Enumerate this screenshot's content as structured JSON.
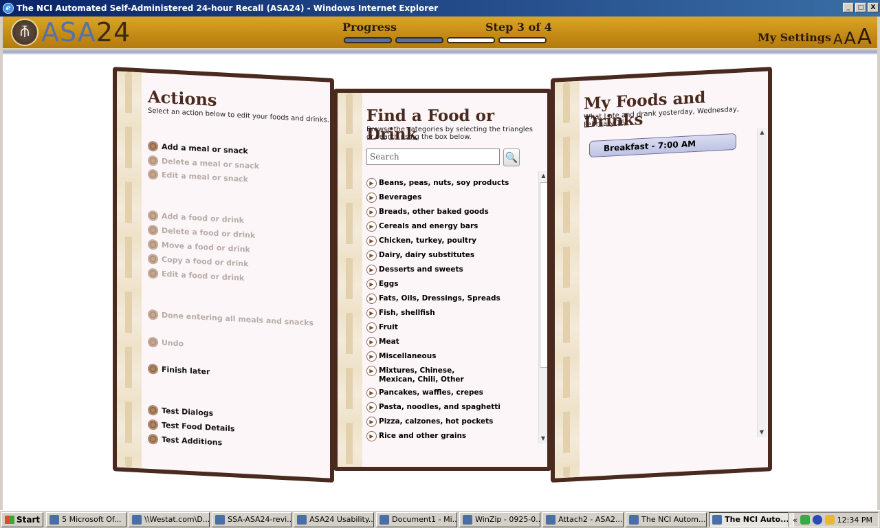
{
  "window": {
    "title": "The NCI Automated Self-Administered 24-hour Recall (ASA24) - Windows Internet Explorer",
    "buttons": [
      "_",
      "□",
      "X"
    ]
  },
  "header": {
    "logo_asa": "ASA",
    "logo_num": "24",
    "progress_label": "Progress",
    "step_label": "Step 3 of 4",
    "progress": {
      "completed_steps": 2,
      "total_steps": 4
    },
    "my_settings": "My Settings",
    "font_sizes": [
      "A",
      "A",
      "A"
    ],
    "brand_colors": {
      "header": "#c48a14",
      "accent": "#5670a8",
      "dark": "#4a2a1e"
    }
  },
  "actions": {
    "title": "Actions",
    "subtitle": "Select an action below to edit your foods and drinks.",
    "items": [
      {
        "label": "Add a meal or snack",
        "enabled": true
      },
      {
        "label": "Delete a meal or snack",
        "enabled": false
      },
      {
        "label": "Edit a meal or snack",
        "enabled": false
      },
      {
        "label": "Add a food or drink",
        "enabled": false
      },
      {
        "label": "Delete a food or drink",
        "enabled": false
      },
      {
        "label": "Move a food or drink",
        "enabled": false
      },
      {
        "label": "Copy a food or drink",
        "enabled": false
      },
      {
        "label": "Edit a food or drink",
        "enabled": false
      },
      {
        "label": "Done entering all meals and snacks",
        "enabled": false
      },
      {
        "label": "Undo",
        "enabled": false
      },
      {
        "label": "Finish later",
        "enabled": true
      },
      {
        "label": "Test Dialogs",
        "enabled": true
      },
      {
        "label": "Test Food Details",
        "enabled": true
      },
      {
        "label": "Test Additions",
        "enabled": true
      }
    ]
  },
  "find": {
    "title": "Find a Food or Drink",
    "subtitle": "Browse the categories by selecting the triangles or search using the box below.",
    "search_placeholder": "Search",
    "categories": [
      "Beans, peas, nuts, soy products",
      "Beverages",
      "Breads, other baked goods",
      "Cereals and energy bars",
      "Chicken, turkey, poultry",
      "Dairy, dairy substitutes",
      "Desserts and sweets",
      "Eggs",
      "Fats, Oils, Dressings, Spreads",
      "Fish, shellfish",
      "Fruit",
      "Meat",
      "Miscellaneous",
      "Mixtures, Chinese, Mexican, Chili, Other",
      "Pancakes, waffles, crepes",
      "Pasta, noodles, and spaghetti",
      "Pizza, calzones, hot pockets",
      "Rice and other grains"
    ]
  },
  "my_foods": {
    "title": "My Foods and Drinks",
    "subtitle": "What I ate and drank  yesterday, Wednesday, February 16.",
    "meals": [
      "Breakfast - 7:00 AM"
    ]
  },
  "taskbar": {
    "start": "Start",
    "tasks": [
      {
        "label": "5 Microsoft Of...",
        "active": false
      },
      {
        "label": "\\\\Westat.com\\D...",
        "active": false
      },
      {
        "label": "SSA-ASA24-revi...",
        "active": false
      },
      {
        "label": "ASA24 Usability...",
        "active": false
      },
      {
        "label": "Document1 - Mi...",
        "active": false
      },
      {
        "label": "WinZip - 0925-0...",
        "active": false
      },
      {
        "label": "Attach2 - ASA2...",
        "active": false
      },
      {
        "label": "The NCI Autom...",
        "active": false
      },
      {
        "label": "The NCI Auto...",
        "active": true
      }
    ],
    "tray_chevron": "«",
    "clock": "12:34 PM"
  }
}
